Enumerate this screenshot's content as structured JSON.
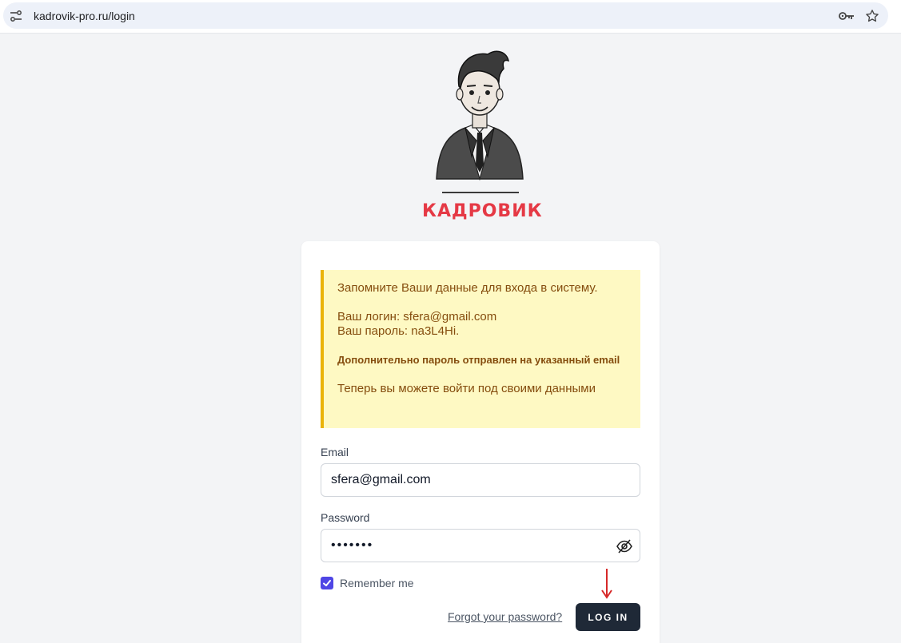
{
  "browser": {
    "url": "kadrovik-pro.ru/login",
    "icons": [
      "site-info-icon",
      "key-icon",
      "star-icon"
    ]
  },
  "logo": {
    "text": "КАДРОВИК",
    "color": "#e53945"
  },
  "notice": {
    "line1": "Запомните Ваши данные для входа в систему.",
    "login_line": "Ваш логин: sfera@gmail.com",
    "password_line": "Ваш пароль: na3L4Hi.",
    "bold_line": "Дополнительно пароль отправлен на указанный email",
    "final_line": "Теперь вы можете войти под своими данными",
    "bg_color": "#fef9c3",
    "border_color": "#eab308"
  },
  "form": {
    "email_label": "Email",
    "email_value": "sfera@gmail.com",
    "password_label": "Password",
    "password_value": "•••••••",
    "remember_label": "Remember me",
    "remember_checked": true,
    "forgot_label": "Forgot your password?",
    "login_label": "LOG IN",
    "accent_color": "#4f46e5"
  }
}
